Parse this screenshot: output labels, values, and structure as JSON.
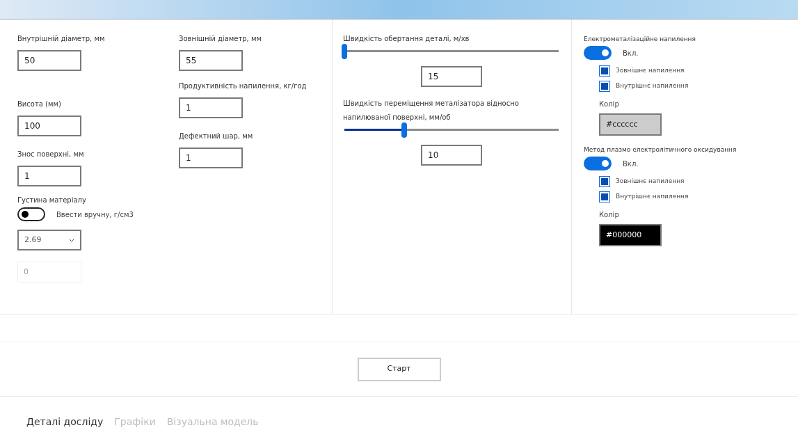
{
  "field_columns": [
    [
      {
        "label": "Внутрішній діаметр, мм",
        "value": "50"
      },
      {
        "label": "Висота (мм)",
        "value": "100"
      },
      {
        "label": "Знос поверхні, мм",
        "value": "1"
      }
    ],
    [
      {
        "label": "Зовнішній діаметр, мм",
        "value": "55"
      },
      {
        "label": "Продуктивність напилення, кг/год",
        "value": "1"
      },
      {
        "label": "Дефектний шар, мм",
        "value": "1"
      }
    ]
  ],
  "density": {
    "label": "Густина матеріалу",
    "toggle": {
      "label": "Ввести вручну, г/см3",
      "on": false
    },
    "select": "2.69",
    "manual": {
      "placeholder": "0",
      "disabled": true
    }
  },
  "sliders": [
    {
      "label": "Швидкість обертання деталі, м/хв",
      "level": 0,
      "value": "15"
    },
    {
      "label": "Швидкість переміщення металізатора відносно напилюваної поверхні, мм/об",
      "level": 0.28,
      "value": "10"
    }
  ],
  "methods": [
    {
      "title": "Електрометалізаційне напилення",
      "toggle": {
        "label": "Вкл.",
        "on": true
      },
      "checks": [
        {
          "label": "Зовнішнє напилення",
          "checked": true
        },
        {
          "label": "Внутрішнє напилення",
          "checked": true
        }
      ],
      "color_label": "Колір",
      "color": "#cccccc"
    },
    {
      "title": "Метод плазмо електролітичного оксидування",
      "toggle": {
        "label": "Вкл.",
        "on": true
      },
      "checks": [
        {
          "label": "Зовнішнє напилення",
          "checked": true
        },
        {
          "label": "Внутрішнє напилення",
          "checked": true
        }
      ],
      "color_label": "Колір",
      "color": "#000000"
    }
  ],
  "start_button": "Старт",
  "tabs": [
    {
      "label": "Деталі досліду",
      "selected": true
    },
    {
      "label": "Графіки",
      "selected": false
    },
    {
      "label": "Візуальна модель",
      "selected": false
    }
  ]
}
